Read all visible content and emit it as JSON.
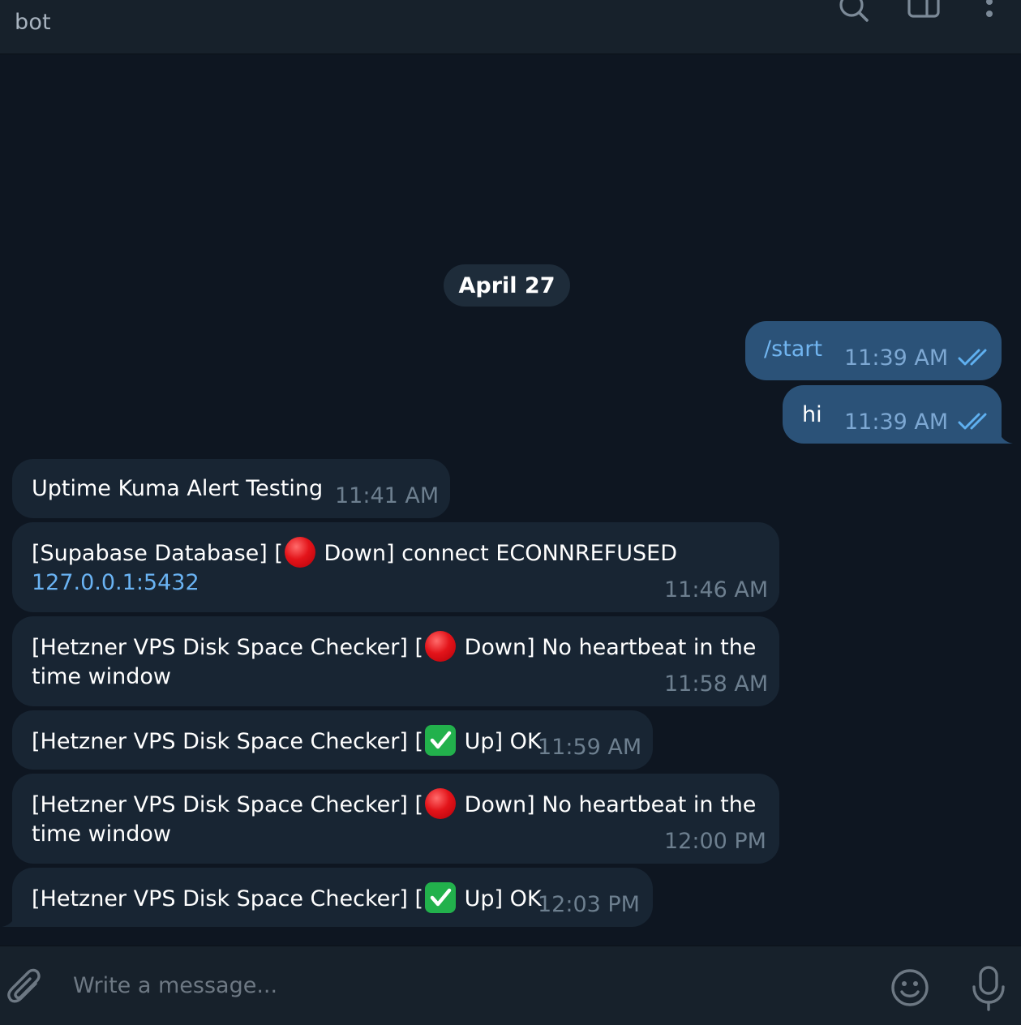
{
  "header": {
    "title": "bot",
    "icons": [
      "search-icon",
      "sidebar-toggle-icon",
      "more-vertical-icon"
    ]
  },
  "date_separator": "April 27",
  "messages": [
    {
      "direction": "out",
      "text": "/start",
      "time": "11:39 AM",
      "status": "read"
    },
    {
      "direction": "out",
      "text": "hi",
      "time": "11:39 AM",
      "status": "read"
    },
    {
      "direction": "in",
      "text": "Uptime Kuma Alert Testing",
      "time": "11:41 AM"
    },
    {
      "direction": "in",
      "text_before": "[Supabase Database] [",
      "emoji": "red-circle",
      "text_after": " Down] connect ECONNREFUSED",
      "link": "127.0.0.1:5432",
      "time": "11:46 AM"
    },
    {
      "direction": "in",
      "text_before": "[Hetzner VPS Disk Space Checker] [",
      "emoji": "red-circle",
      "text_after": " Down] No heartbeat in the",
      "line2": "time window",
      "time": "11:58 AM"
    },
    {
      "direction": "in",
      "text_before": "[Hetzner VPS Disk Space Checker] [",
      "emoji": "check-mark",
      "text_after": " Up] OK",
      "time": "11:59 AM"
    },
    {
      "direction": "in",
      "text_before": "[Hetzner VPS Disk Space Checker] [",
      "emoji": "red-circle",
      "text_after": " Down] No heartbeat in the",
      "line2": "time window",
      "time": "12:00 PM"
    },
    {
      "direction": "in",
      "text_before": "[Hetzner VPS Disk Space Checker] [",
      "emoji": "check-mark",
      "text_after": " Up] OK",
      "time": "12:03 PM"
    }
  ],
  "composer": {
    "placeholder": "Write a message...",
    "value": "",
    "icons": [
      "paperclip-icon",
      "emoji-icon",
      "microphone-icon"
    ]
  },
  "colors": {
    "background": "#0e1621",
    "header": "#17212b",
    "incoming_bubble": "#182533",
    "outgoing_bubble": "#2b5278",
    "link": "#6ab3f3",
    "read_ticks": "#5fb0f0"
  }
}
